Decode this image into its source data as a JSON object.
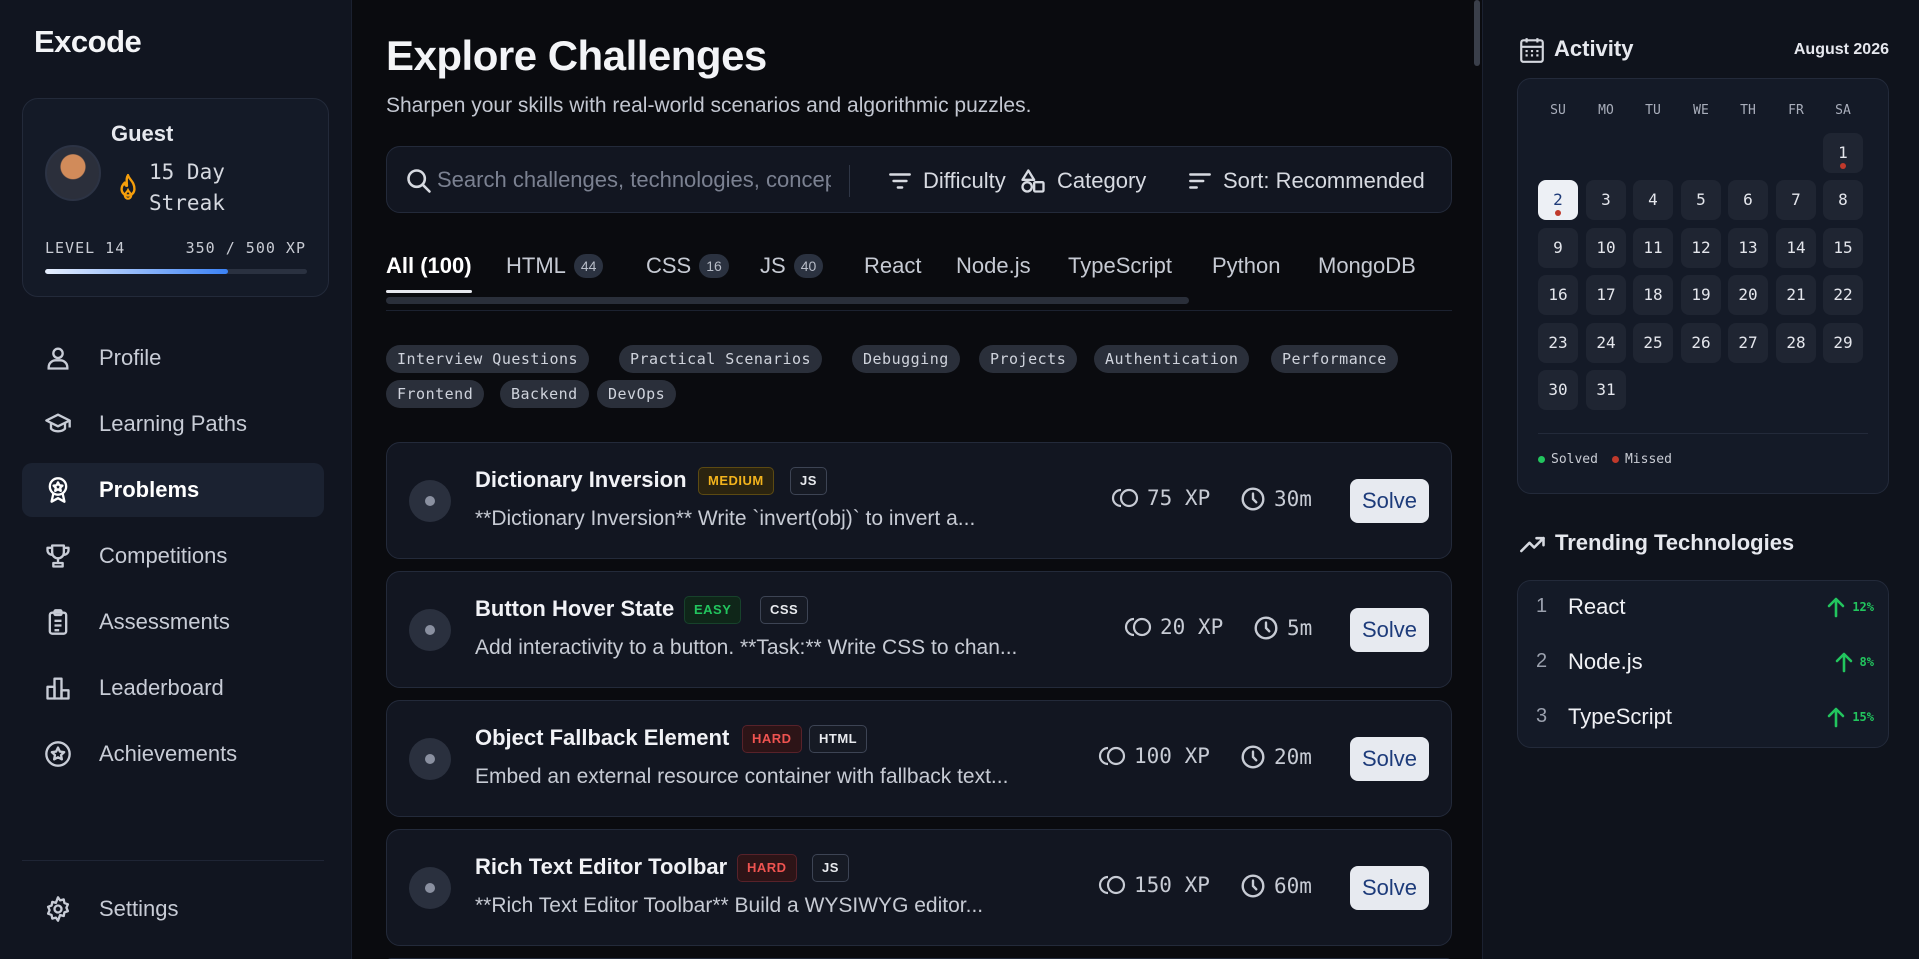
{
  "app": {
    "logo": "Excode"
  },
  "profile": {
    "name": "Guest",
    "streak": "15 Day Streak",
    "level": "LEVEL 14",
    "xp": "350 / 500 XP",
    "xp_progress": 0.7
  },
  "nav": {
    "items": [
      {
        "label": "Profile",
        "icon": "user-icon"
      },
      {
        "label": "Learning Paths",
        "icon": "graduation-cap-icon"
      },
      {
        "label": "Problems",
        "icon": "award-icon",
        "active": true
      },
      {
        "label": "Competitions",
        "icon": "trophy-icon"
      },
      {
        "label": "Assessments",
        "icon": "clipboard-icon"
      },
      {
        "label": "Leaderboard",
        "icon": "bar-chart-icon"
      },
      {
        "label": "Achievements",
        "icon": "star-circle-icon"
      }
    ],
    "settings": "Settings"
  },
  "main": {
    "title": "Explore Challenges",
    "subtitle": "Sharpen your skills with real-world scenarios and algorithmic puzzles.",
    "search": {
      "placeholder": "Search challenges, technologies, concepts..."
    },
    "filters": {
      "difficulty": "Difficulty",
      "category": "Category",
      "sort": "Sort: Recommended"
    },
    "tabs": [
      {
        "label": "All (100)",
        "count": ""
      },
      {
        "label": "HTML",
        "count": "44"
      },
      {
        "label": "CSS",
        "count": "16"
      },
      {
        "label": "JS",
        "count": "40"
      },
      {
        "label": "React",
        "count": ""
      },
      {
        "label": "Node.js",
        "count": ""
      },
      {
        "label": "TypeScript",
        "count": ""
      },
      {
        "label": "Python",
        "count": ""
      },
      {
        "label": "MongoDB",
        "count": ""
      }
    ],
    "chips": [
      "Interview Questions",
      "Practical Scenarios",
      "Debugging",
      "Projects",
      "Authentication",
      "Performance",
      "Frontend",
      "Backend",
      "DevOps"
    ],
    "challenges": [
      {
        "title": "Dictionary Inversion",
        "difficulty": "MEDIUM",
        "tech": "JS",
        "desc": "**Dictionary Inversion** Write `invert(obj)` to invert a...",
        "xp": "75 XP",
        "time": "30m",
        "action": "Solve"
      },
      {
        "title": "Button Hover State",
        "difficulty": "EASY",
        "tech": "CSS",
        "desc": "Add interactivity to a button. **Task:** Write CSS to chan...",
        "xp": "20 XP",
        "time": "5m",
        "action": "Solve"
      },
      {
        "title": "Object Fallback Element",
        "difficulty": "HARD",
        "tech": "HTML",
        "desc": "Embed an external resource container with fallback text...",
        "xp": "100 XP",
        "time": "20m",
        "action": "Solve"
      },
      {
        "title": "Rich Text Editor Toolbar",
        "difficulty": "HARD",
        "tech": "JS",
        "desc": "**Rich Text Editor Toolbar** Build a WYSIWYG editor...",
        "xp": "150 XP",
        "time": "60m",
        "action": "Solve"
      }
    ]
  },
  "activity": {
    "title": "Activity",
    "month": "August 2026",
    "weekdays": [
      "SU",
      "MO",
      "TU",
      "WE",
      "TH",
      "FR",
      "SA"
    ],
    "days": [
      "1",
      "2",
      "3",
      "4",
      "5",
      "6",
      "7",
      "8",
      "9",
      "10",
      "11",
      "12",
      "13",
      "14",
      "15",
      "16",
      "17",
      "18",
      "19",
      "20",
      "21",
      "22",
      "23",
      "24",
      "25",
      "26",
      "27",
      "28",
      "29",
      "30",
      "31"
    ],
    "legend": {
      "solved": "Solved",
      "missed": "Missed"
    },
    "colors": {
      "solved": "#22c55e",
      "missed": "#c0392b"
    }
  },
  "trending": {
    "title": "Trending Technologies",
    "items": [
      {
        "rank": "1",
        "name": "React",
        "growth": "12%"
      },
      {
        "rank": "2",
        "name": "Node.js",
        "growth": "8%"
      },
      {
        "rank": "3",
        "name": "TypeScript",
        "growth": "15%"
      }
    ]
  }
}
